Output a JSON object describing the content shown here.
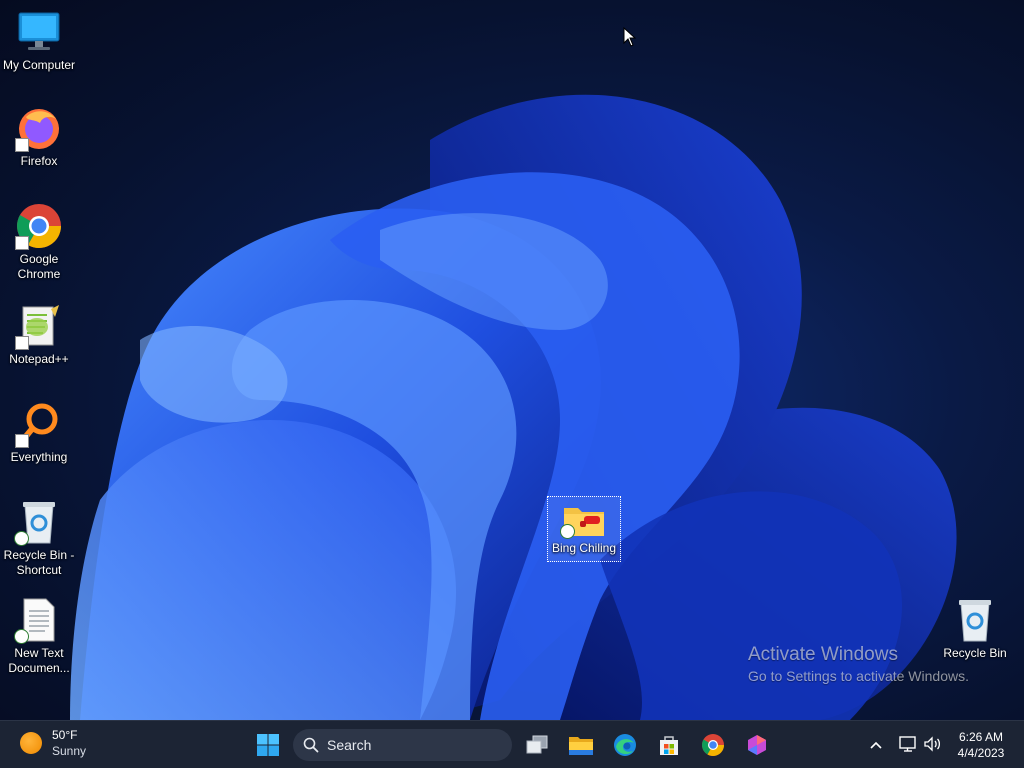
{
  "desktop": {
    "icons": [
      {
        "label": "My Computer",
        "icon": "computer-icon"
      },
      {
        "label": "Firefox",
        "icon": "firefox-icon"
      },
      {
        "label": "Google\nChrome",
        "icon": "chrome-icon"
      },
      {
        "label": "Notepad++",
        "icon": "notepadpp-icon"
      },
      {
        "label": "Everything",
        "icon": "everything-search-icon"
      },
      {
        "label": "Recycle Bin -\nShortcut",
        "icon": "recycle-bin-icon"
      },
      {
        "label": "New Text\nDocumen...",
        "icon": "text-document-icon"
      },
      {
        "label": "Bing Chiling",
        "icon": "folder-icon",
        "selected": true
      },
      {
        "label": "Recycle Bin",
        "icon": "recycle-bin-icon"
      }
    ]
  },
  "watermark": {
    "title": "Activate Windows",
    "subtitle": "Go to Settings to activate Windows."
  },
  "taskbar": {
    "weather": {
      "temp": "50°F",
      "condition": "Sunny"
    },
    "search_placeholder": "Search",
    "pinned": [
      "start-icon",
      "task-view-icon",
      "file-explorer-icon",
      "edge-icon",
      "store-icon",
      "chrome-icon",
      "copilot-icon"
    ],
    "clock": {
      "time": "6:26 AM",
      "date": "4/4/2023"
    }
  },
  "colors": {
    "taskbar_bg": "#1c2434",
    "accent_blue": "#2f6bff",
    "wallpaper_dark": "#071230"
  }
}
